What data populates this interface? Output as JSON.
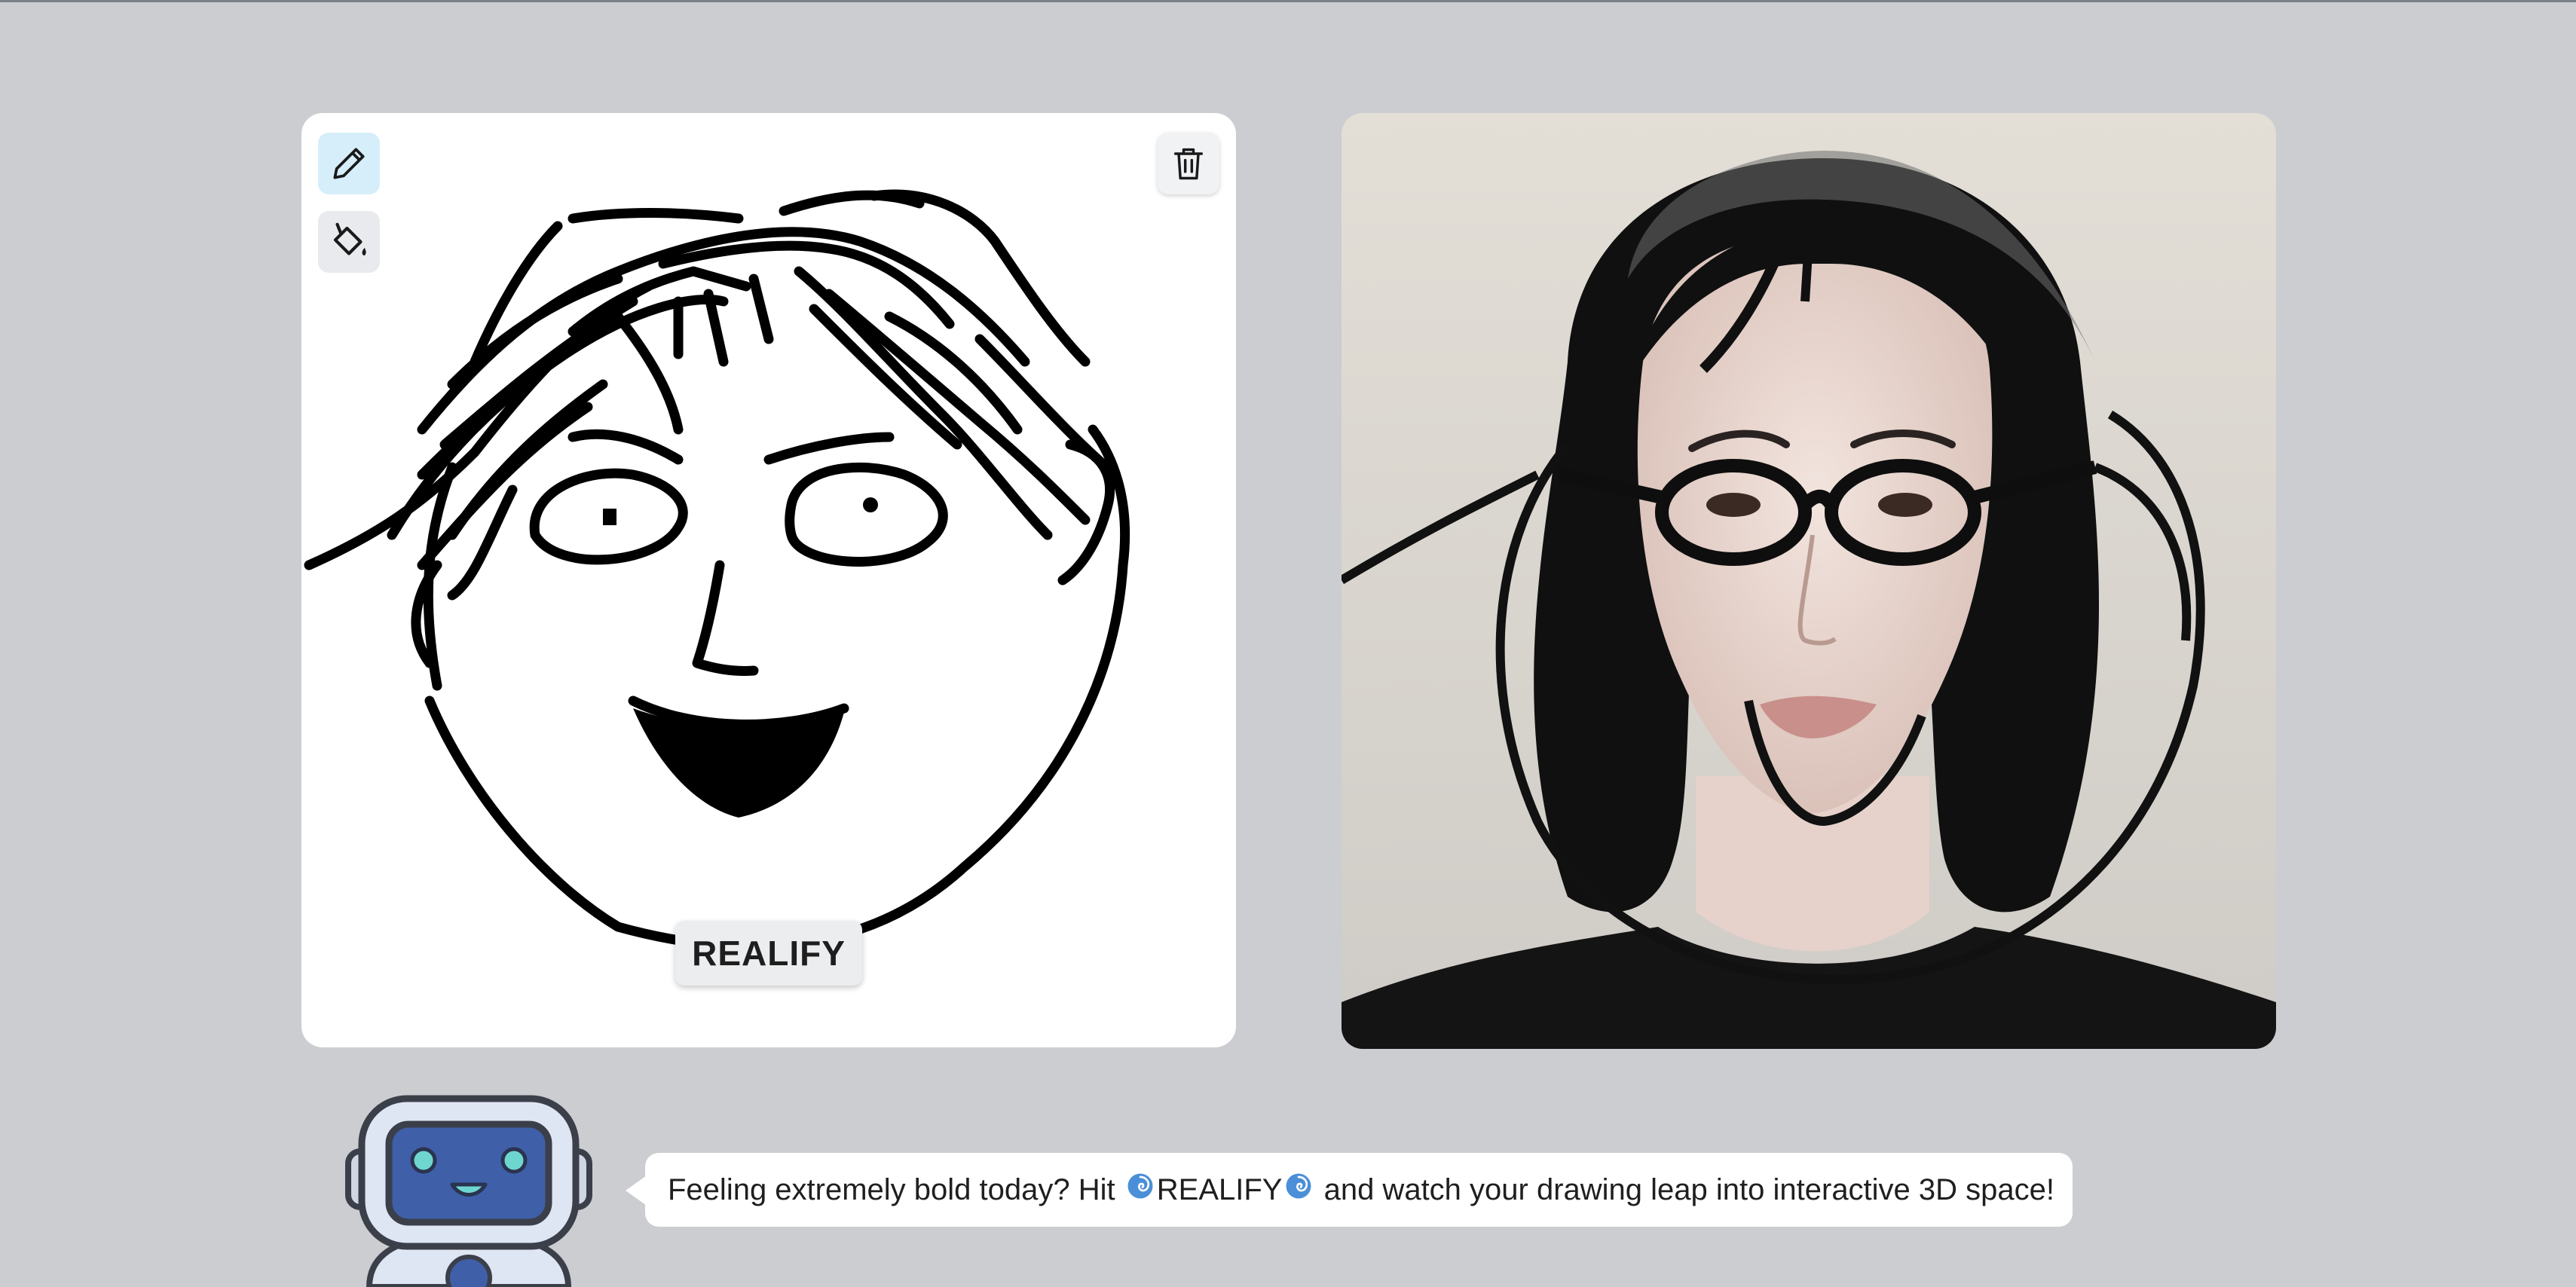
{
  "toolbar": {
    "pencil_icon": "pencil-icon",
    "fill_icon": "paint-bucket-icon",
    "trash_icon": "trash-icon",
    "active_tool": "pencil"
  },
  "canvas": {
    "realify_label": "REALIFY"
  },
  "result": {
    "image_icon": "generated-portrait"
  },
  "assistant": {
    "avatar_icon": "robot-icon",
    "message_before": "Feeling extremely bold today? Hit ",
    "message_keyword": "REALIFY",
    "message_after": " and watch your drawing leap into interactive 3D space!",
    "swirl_icon": "cyclone-icon"
  },
  "colors": {
    "background": "#cbcdd1",
    "active_tool_bg": "#d6eefa",
    "robot_screen": "#3f5fa8",
    "robot_eyes": "#6fd6cf"
  }
}
